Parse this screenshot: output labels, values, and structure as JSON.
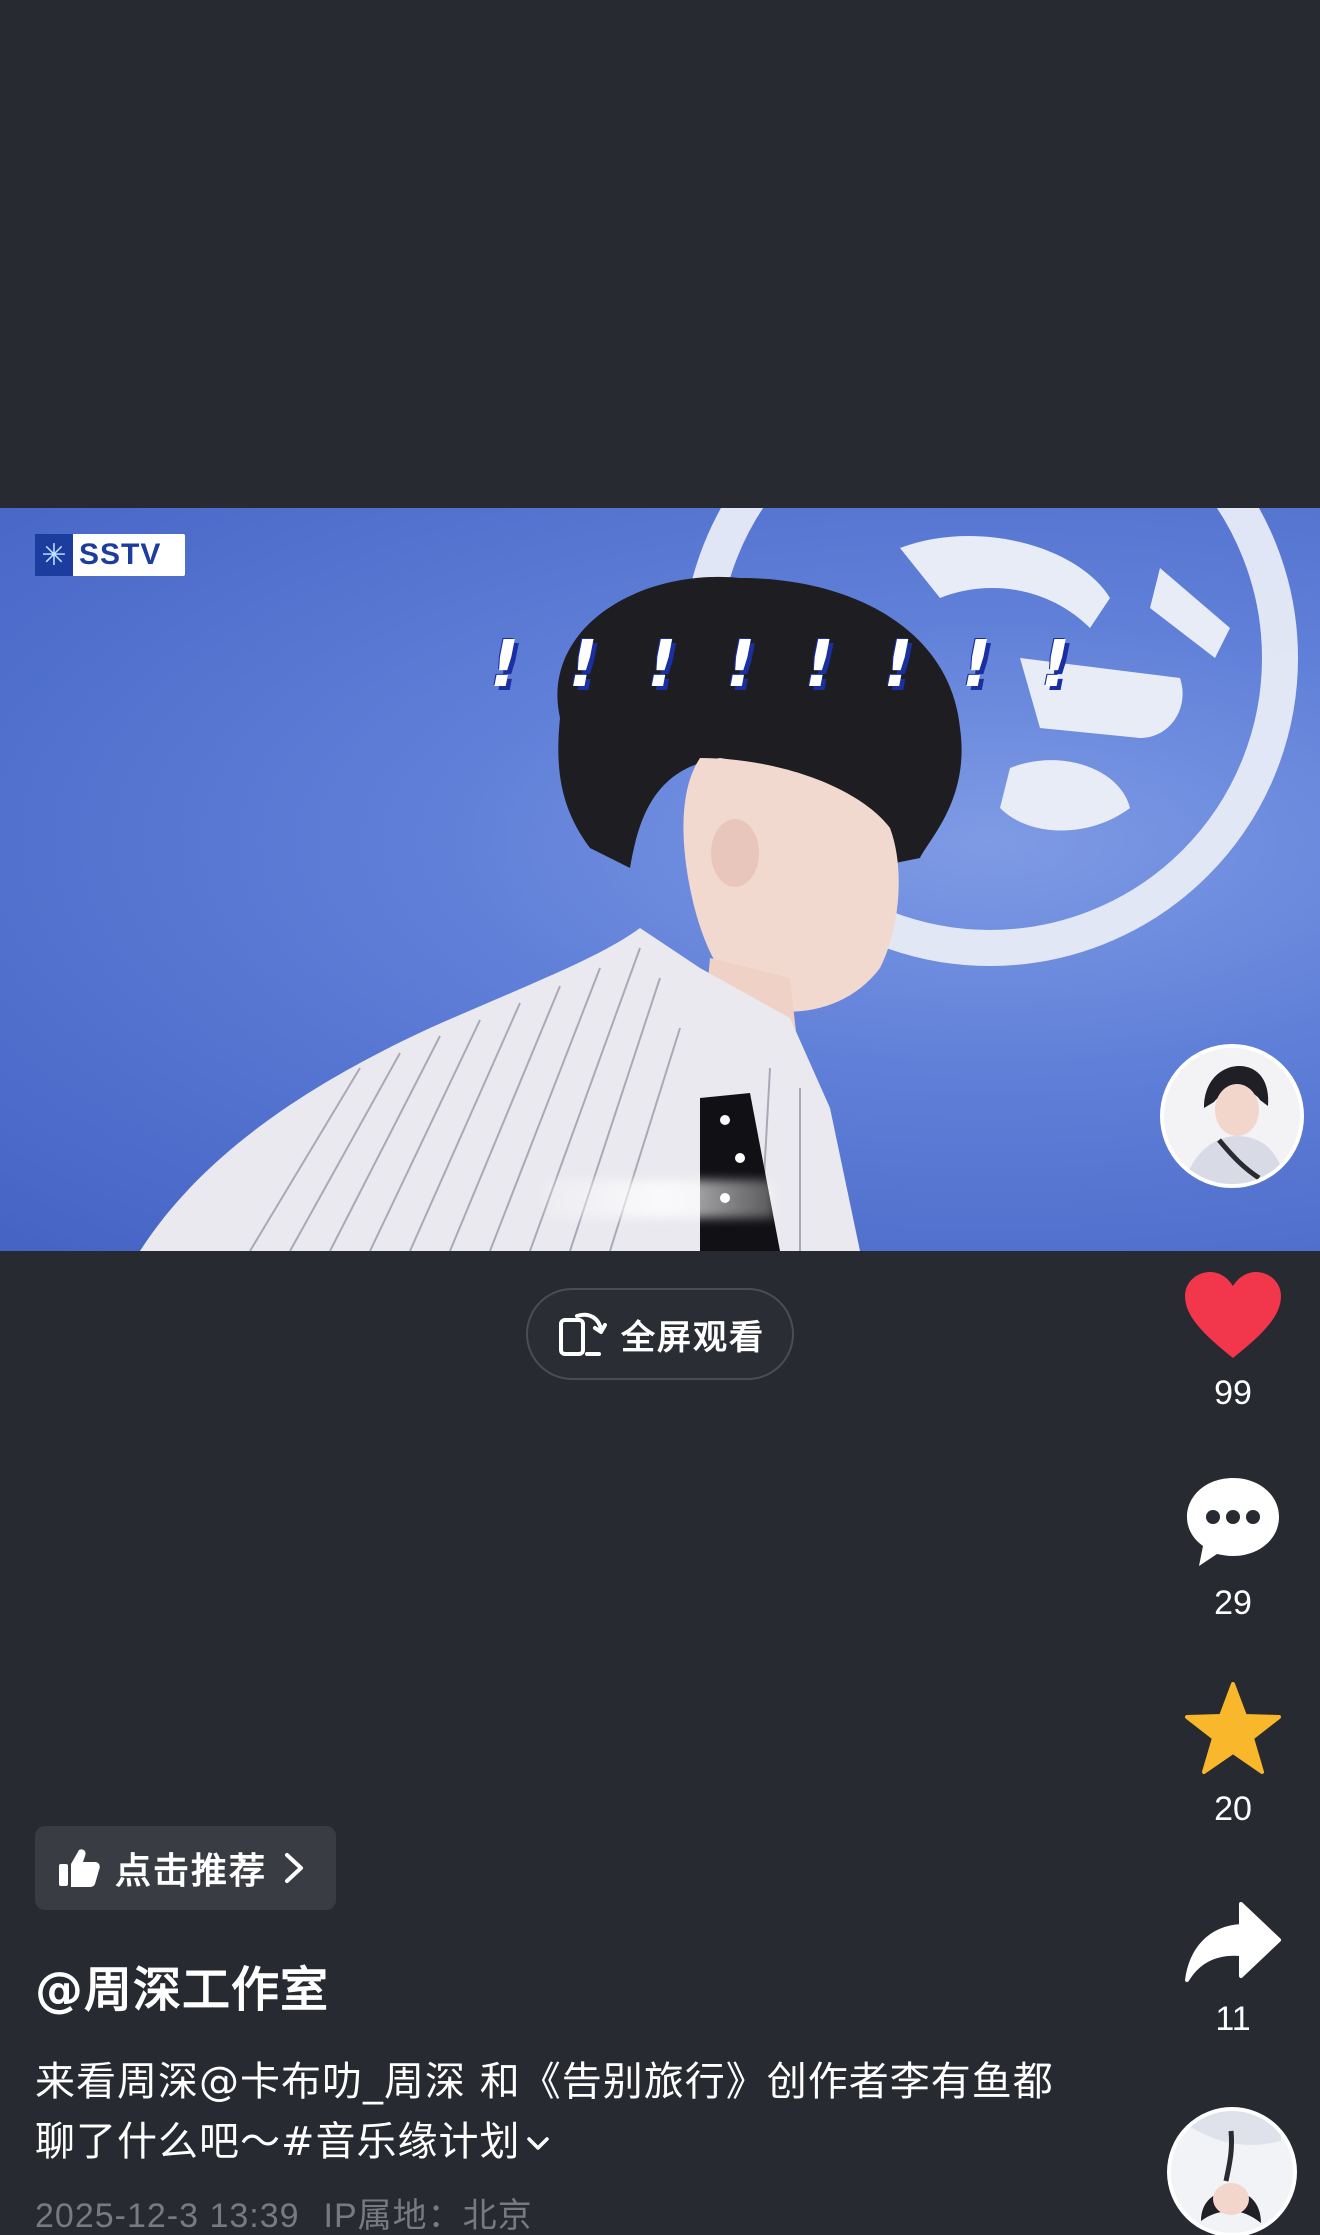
{
  "video": {
    "channel_logo": "SSTV",
    "overlay_text": "!!!!!!!!"
  },
  "fullscreen_button": {
    "label": "全屏观看",
    "icon": "rotate-screen-icon"
  },
  "actions": {
    "like": {
      "count": "99",
      "icon": "heart-icon",
      "color": "#f2364b"
    },
    "comment": {
      "count": "29",
      "icon": "comment-bubble-icon"
    },
    "favorite": {
      "count": "20",
      "icon": "star-icon",
      "color": "#f9b72b"
    },
    "share": {
      "count": "11",
      "icon": "share-arrow-icon"
    }
  },
  "recommend_chip": {
    "label": "点击推荐",
    "icon": "thumbs-up-icon"
  },
  "post": {
    "author": "@周深工作室",
    "description": "来看周深@卡布叻_周深 和《告别旅行》创作者李有鱼都聊了什么吧～#音乐缘计划",
    "date": "2025-12-3 13:39",
    "ip_location": "IP属地：北京"
  }
}
